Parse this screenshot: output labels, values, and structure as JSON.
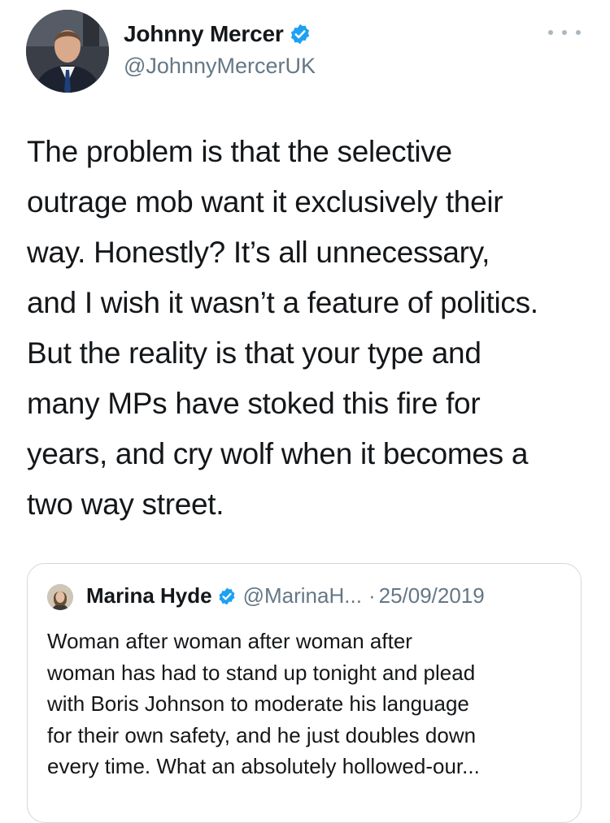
{
  "author": {
    "display_name": "Johnny Mercer",
    "handle": "@JohnnyMercerUK",
    "verified": true,
    "avatar_icon": "profile-photo"
  },
  "tweet": {
    "lines": [
      "The problem is that the selective",
      "outrage mob want it exclusively their",
      "way. Honestly? It’s all unnecessary,",
      "and I wish it wasn’t a feature of politics.",
      "But the reality is that your type and",
      "many MPs have stoked this fire for",
      "years, and cry wolf when it becomes a",
      "two way street."
    ]
  },
  "quoted_tweet": {
    "display_name": "Marina Hyde",
    "handle": "@MarinaH...",
    "separator": "·",
    "date": "25/09/2019",
    "verified": true,
    "lines": [
      "Woman after woman after woman after",
      "woman has had to stand up tonight and plead",
      "with Boris Johnson to moderate his language",
      "for their own safety, and he just doubles down",
      "every time. What an absolutely hollowed-our..."
    ]
  },
  "colors": {
    "verified_blue": "#1da1f2",
    "text_primary": "#14171a",
    "text_secondary": "#657786",
    "border": "#cfd9de"
  }
}
